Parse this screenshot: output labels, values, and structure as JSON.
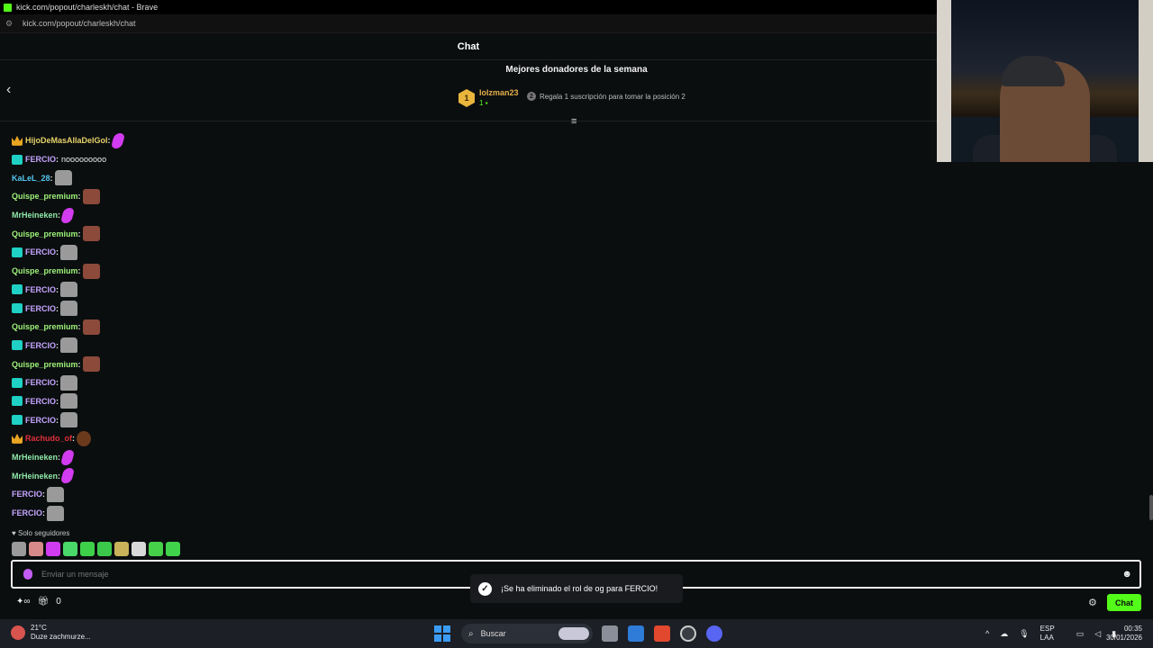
{
  "browser": {
    "window_title": "kick.com/popout/charleskh/chat - Brave",
    "url": "kick.com/popout/charleskh/chat"
  },
  "chat": {
    "header": "Chat",
    "donors_title": "Mejores donadores de la semana",
    "top_donor": {
      "rank": "1",
      "name": "lolzman23",
      "count": "1"
    },
    "second_slot": {
      "rank": "2",
      "text": "Regala 1 suscripción para tomar la posición 2"
    }
  },
  "messages": [
    {
      "user": "HijoDeMasAllaDelGol",
      "color": "#e6d26a",
      "badge": "crown",
      "text": "",
      "emote": "pink"
    },
    {
      "user": "FERCIO",
      "color": "#c5a5ff",
      "badge": "og",
      "text": "nooooooooo",
      "emote": ""
    },
    {
      "user": "KaLeL_28",
      "color": "#53c7f0",
      "badge": "",
      "text": "",
      "emote": "cat"
    },
    {
      "user": "Quispe_premium",
      "color": "#9ef37a",
      "badge": "",
      "text": "",
      "emote": "face"
    },
    {
      "user": "MrHeineken",
      "color": "#8fe9a8",
      "badge": "",
      "text": "",
      "emote": "pink"
    },
    {
      "user": "Quispe_premium",
      "color": "#9ef37a",
      "badge": "",
      "text": "",
      "emote": "face"
    },
    {
      "user": "FERCIO",
      "color": "#c5a5ff",
      "badge": "og",
      "text": "",
      "emote": "cat"
    },
    {
      "user": "Quispe_premium",
      "color": "#9ef37a",
      "badge": "",
      "text": "",
      "emote": "face"
    },
    {
      "user": "FERCIO",
      "color": "#c5a5ff",
      "badge": "og",
      "text": "",
      "emote": "cat"
    },
    {
      "user": "FERCIO",
      "color": "#c5a5ff",
      "badge": "og",
      "text": "",
      "emote": "cat"
    },
    {
      "user": "Quispe_premium",
      "color": "#9ef37a",
      "badge": "",
      "text": "",
      "emote": "face"
    },
    {
      "user": "FERCIO",
      "color": "#c5a5ff",
      "badge": "og",
      "text": "",
      "emote": "cat"
    },
    {
      "user": "Quispe_premium",
      "color": "#9ef37a",
      "badge": "",
      "text": "",
      "emote": "face"
    },
    {
      "user": "FERCIO",
      "color": "#c5a5ff",
      "badge": "og",
      "text": "",
      "emote": "cat"
    },
    {
      "user": "FERCIO",
      "color": "#c5a5ff",
      "badge": "og",
      "text": "",
      "emote": "cat"
    },
    {
      "user": "FERCIO",
      "color": "#c5a5ff",
      "badge": "og",
      "text": "",
      "emote": "cat"
    },
    {
      "user": "Rachudo_of",
      "color": "#e0303a",
      "badge": "crown",
      "text": "",
      "emote": "brown"
    },
    {
      "user": "MrHeineken",
      "color": "#8fe9a8",
      "badge": "",
      "text": "",
      "emote": "pink"
    },
    {
      "user": "MrHeineken",
      "color": "#8fe9a8",
      "badge": "",
      "text": "",
      "emote": "pink"
    },
    {
      "user": "FERCIO",
      "color": "#c5a5ff",
      "badge": "",
      "text": "",
      "emote": "cat"
    },
    {
      "user": "FERCIO",
      "color": "#c5a5ff",
      "badge": "",
      "text": "",
      "emote": "cat"
    }
  ],
  "follow_mode": "Solo seguidores",
  "emote_bar": [
    "#9a9a9a",
    "#d88a8a",
    "#d23cf0",
    "#4ad86a",
    "#3fd04a",
    "#3cc84a",
    "#c9b25a",
    "#d9d9d9",
    "#46d04a",
    "#41d24b"
  ],
  "composer": {
    "placeholder": "Enviar un mensaje"
  },
  "toast": {
    "text": "¡Se ha eliminado el rol de og para FERCIO!"
  },
  "bottom": {
    "gift_count": "0",
    "chat_button": "Chat"
  },
  "taskbar": {
    "temperature": "21°C",
    "weather_text": "Duze zachmurze...",
    "search_label": "Buscar",
    "lang_line1": "ESP",
    "lang_line2": "LAA",
    "time": "00:35",
    "date": "30/01/2026"
  },
  "colors": {
    "accent": "#53fc18",
    "background": "#0b0e0f"
  }
}
